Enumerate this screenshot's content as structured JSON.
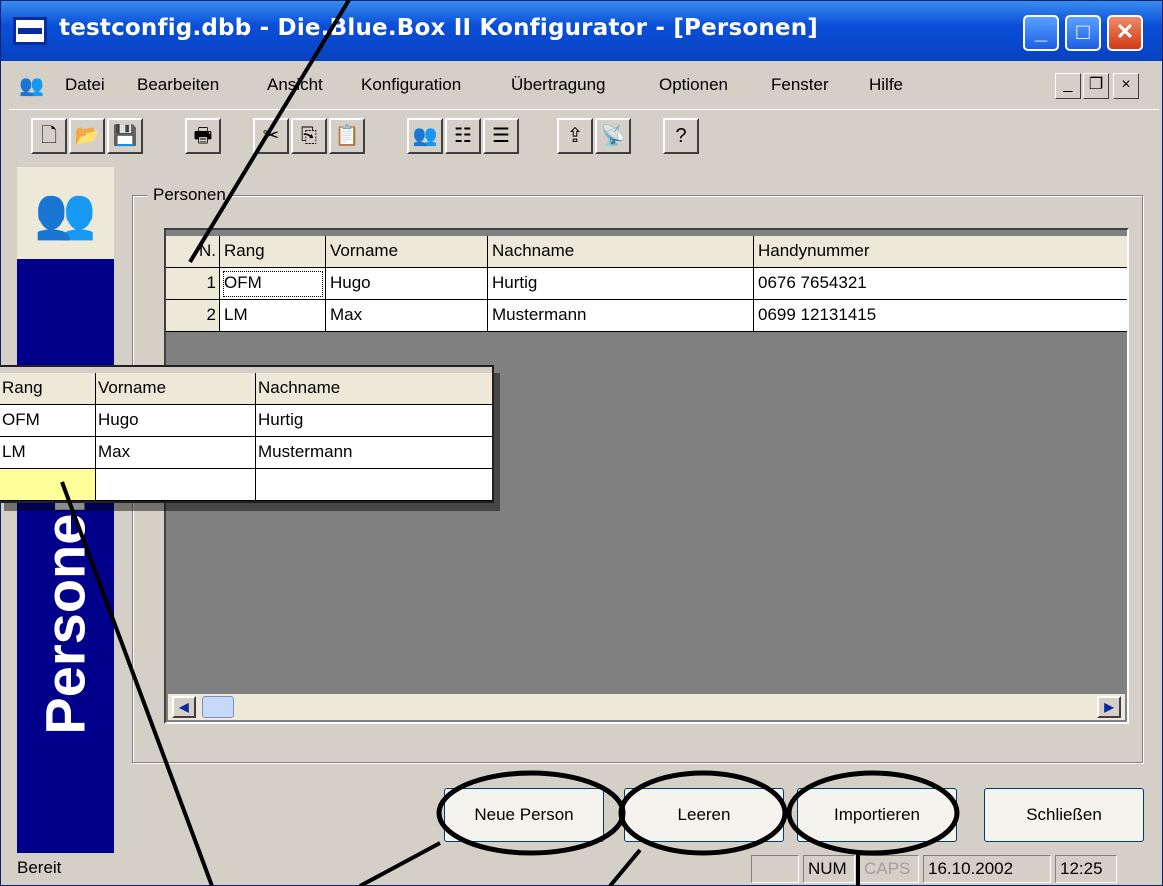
{
  "window": {
    "title": "testconfig.dbb - Die.Blue.Box II Konfigurator - [Personen]",
    "controls": {
      "minimize": "_",
      "maximize": "□",
      "close": "✕"
    }
  },
  "menu": {
    "items": [
      "Datei",
      "Bearbeiten",
      "Ansicht",
      "Konfiguration",
      "Übertragung",
      "Optionen",
      "Fenster",
      "Hilfe"
    ],
    "mdi_controls": {
      "minimize": "_",
      "restore": "❐",
      "close": "×"
    }
  },
  "toolbar": {
    "buttons": [
      {
        "icon": "new-document-icon",
        "glyph": "🗋"
      },
      {
        "icon": "open-folder-icon",
        "glyph": "📂"
      },
      {
        "icon": "save-icon",
        "glyph": "💾"
      },
      {
        "icon": "print-icon",
        "glyph": "🖶"
      },
      {
        "icon": "cut-icon",
        "glyph": "✂"
      },
      {
        "icon": "copy-icon",
        "glyph": "⎘"
      },
      {
        "icon": "paste-icon",
        "glyph": "📋"
      },
      {
        "icon": "persons-icon",
        "glyph": "👥"
      },
      {
        "icon": "config-list-icon",
        "glyph": "☷"
      },
      {
        "icon": "list-icon",
        "glyph": "☰"
      },
      {
        "icon": "upload-icon",
        "glyph": "⇪"
      },
      {
        "icon": "transfer-icon",
        "glyph": "📡"
      },
      {
        "icon": "help-icon",
        "glyph": "?"
      }
    ]
  },
  "sidebar": {
    "label": "Personen",
    "icon": "persons-icon"
  },
  "group": {
    "label": "Personen"
  },
  "grid": {
    "columns": [
      "Nr.",
      "Rang",
      "Vorname",
      "Nachname",
      "Handynummer"
    ],
    "header_visible": [
      "N.",
      "Rang",
      "Vorname",
      "Nachname",
      "Handynummer"
    ],
    "rows": [
      {
        "nr": "1",
        "rang": "OFM",
        "vorname": "Hugo",
        "nachname": "Hurtig",
        "handy": "0676 7654321"
      },
      {
        "nr": "2",
        "rang": "LM",
        "vorname": "Max",
        "nachname": "Mustermann",
        "handy": "0699 12131415"
      }
    ]
  },
  "zoom_callout": {
    "columns": [
      "Rang",
      "Vorname",
      "Nachname"
    ],
    "rows": [
      {
        "rang": "OFM",
        "vorname": "Hugo",
        "nachname": "Hurtig"
      },
      {
        "rang": "LM",
        "vorname": "Max",
        "nachname": "Mustermann"
      },
      {
        "rang": "",
        "vorname": "",
        "nachname": ""
      }
    ]
  },
  "buttons": {
    "new_person": "Neue Person",
    "clear": "Leeren",
    "import": "Importieren",
    "close": "Schließen"
  },
  "statusbar": {
    "text": "Bereit",
    "num": "NUM",
    "caps": "CAPS",
    "date": "16.10.2002",
    "time": "12:25"
  }
}
